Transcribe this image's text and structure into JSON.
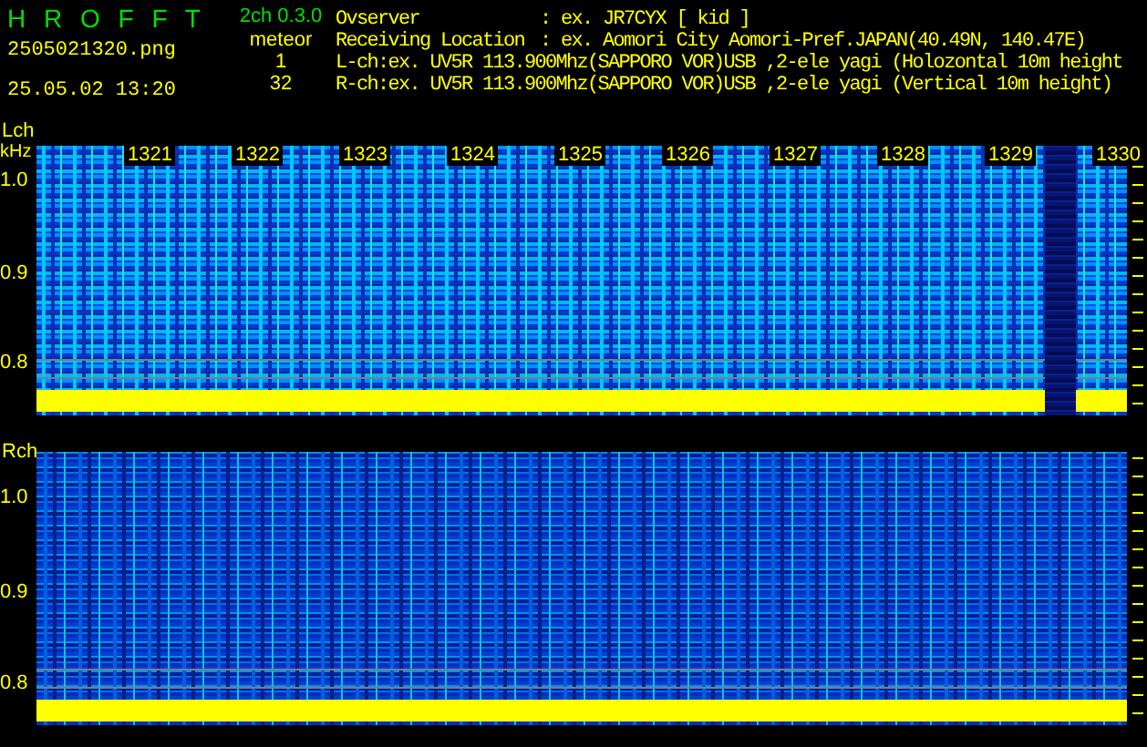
{
  "header": {
    "app_title": "H R O F F T",
    "filename": "2505021320.png",
    "datetime": "25.05.02 13:20",
    "version": "2ch 0.3.0",
    "mode": "meteor",
    "count_l": "1",
    "count_r": "32",
    "info": [
      {
        "kind": "field",
        "label": "Ovserver",
        "value": ": ex. JR7CYX [ kid ]"
      },
      {
        "kind": "field",
        "label": "Receiving Location",
        "value": ": ex. Aomori City Aomori-Pref.JAPAN(40.49N, 140.47E)"
      },
      {
        "kind": "line",
        "text": "L-ch:ex. UV5R 113.900Mhz(SAPPORO VOR)USB ,2-ele yagi (Holozontal 10m height"
      },
      {
        "kind": "line",
        "text": "R-ch:ex. UV5R 113.900Mhz(SAPPORO VOR)USB ,2-ele yagi (Vertical 10m height)"
      }
    ]
  },
  "panels": [
    {
      "channel": "Lch",
      "unit": "kHz",
      "times": [
        "1321",
        "1322",
        "1323",
        "1324",
        "1325",
        "1326",
        "1327",
        "1328",
        "1329",
        "1330"
      ],
      "yticks": [
        "1.0",
        "0.9",
        "0.8"
      ]
    },
    {
      "channel": "Rch",
      "yticks": [
        "1.0",
        "0.9",
        "0.8"
      ]
    }
  ]
}
